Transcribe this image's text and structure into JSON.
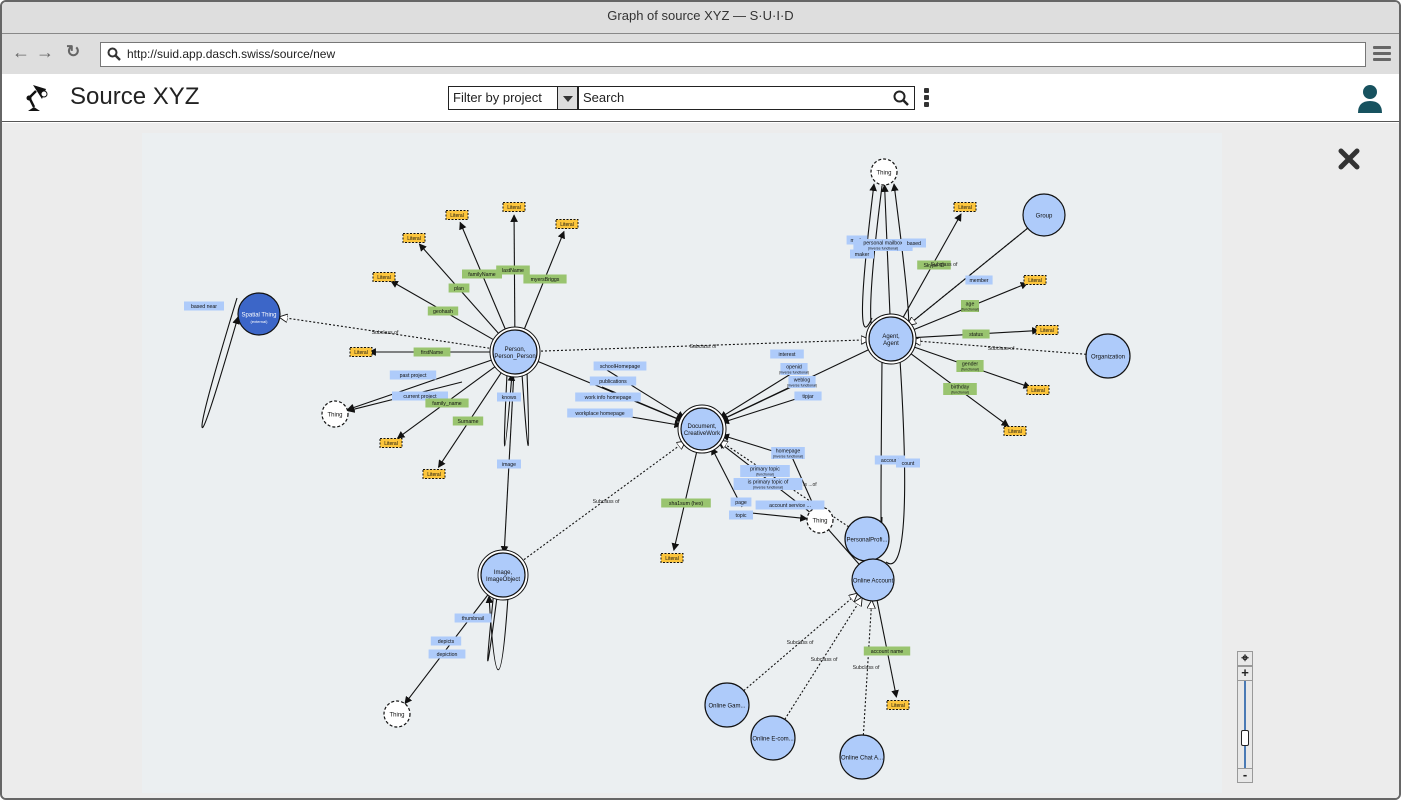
{
  "window": {
    "title": "Graph of source XYZ — S·U·I·D"
  },
  "browser": {
    "url": "http://suid.app.dasch.swiss/source/new"
  },
  "header": {
    "title": "Source XYZ",
    "filter_label": "Filter by project",
    "search_placeholder": "Search"
  },
  "colors": {
    "class_node": "#aecbfa",
    "external_node": "#3c66c8",
    "thing_node": "#ffffff",
    "literal": "#fcc53c",
    "object_property": "#aecbfa",
    "datatype_property": "#99c46f",
    "accent": "#17525f"
  },
  "zoom_control": {
    "level": 0.25
  },
  "graph": {
    "nodes": [
      {
        "id": "spatial",
        "label": "Spatial Thing",
        "sub": "(external)",
        "type": "external"
      },
      {
        "id": "person",
        "label": "Person,\nPerson_Person",
        "type": "class"
      },
      {
        "id": "document",
        "label": "Document,\nCreativeWork",
        "type": "class"
      },
      {
        "id": "agent",
        "label": "Agent,\nAgent",
        "type": "class"
      },
      {
        "id": "image",
        "label": "Image,\nImageObject",
        "type": "class"
      },
      {
        "id": "group",
        "label": "Group",
        "type": "plain"
      },
      {
        "id": "organization",
        "label": "Organization",
        "type": "plain"
      },
      {
        "id": "profile",
        "label": "PersonalProfi...",
        "type": "plain"
      },
      {
        "id": "account",
        "label": "Online Account",
        "type": "plain"
      },
      {
        "id": "gaming",
        "label": "Online Gam...",
        "type": "plain"
      },
      {
        "id": "ecom",
        "label": "Online E-com...",
        "type": "plain"
      },
      {
        "id": "chat",
        "label": "Online Chat A...",
        "type": "plain"
      },
      {
        "id": "thing1",
        "label": "Thing",
        "type": "thing"
      },
      {
        "id": "thing2",
        "label": "Thing",
        "type": "thing"
      },
      {
        "id": "thing3",
        "label": "Thing",
        "type": "thing"
      },
      {
        "id": "thing4",
        "label": "Thing",
        "type": "thing"
      }
    ],
    "literals": [
      "Literal",
      "Literal",
      "Literal",
      "Literal",
      "Literal",
      "Literal",
      "Literal",
      "Literal",
      "Literal",
      "Literal",
      "Literal",
      "Literal",
      "Literal",
      "Literal",
      "Literal"
    ],
    "properties": {
      "based_near": "based near",
      "geohash": "geohash",
      "plan": "plan",
      "familyName": "familyName",
      "lastName": "lastName",
      "myersBriggs": "myersBriggs",
      "firstName": "firstName",
      "past_project": "past project",
      "current_project": "current project",
      "family_name": "family_name",
      "surname": "Surname",
      "knows": "knows",
      "image": "image",
      "school_homepage": "schoolHomepage",
      "publications": "publications",
      "work_info_homepage": "work info homepage",
      "workplace_homepage": "workplace homepage",
      "sha1sum": "sha1sum (hex)",
      "thumbnail": "thumbnail",
      "depicts": "depicts",
      "depiction": "depiction",
      "homepage": "homepage",
      "homepage_sub": "(inverse functional)",
      "primary_topic": "primary topic",
      "primary_topic_sub": "(functional)",
      "is_primary_topic_of": "is primary topic of",
      "is_primary_topic_of_sub": "(inverse functional)",
      "page": "page",
      "topic": "topic",
      "account_service": "account service ...",
      "interest": "interest",
      "openid": "openid",
      "openid_sub": "(inverse functional)",
      "weblog": "weblog",
      "weblog_sub": "(inverse functional)",
      "tipjar": "tipjar",
      "made": "made",
      "maker": "maker",
      "personal_mailbox": "personal mailbox",
      "personal_mailbox_sub": "(inverse functional)",
      "mbox_sha1sum": "based",
      "skype_id": "Skype ID",
      "member": "member",
      "age": "age",
      "age_sub": "(functional)",
      "status": "status",
      "gender": "gender",
      "gender_sub": "(functional)",
      "birthday": "birthday",
      "birthday_sub": "(functional)",
      "account": "account",
      "holds_account": "count",
      "account_name": "account name",
      "is_topic_of": "is ...of"
    },
    "subclass_label": "Subclass of"
  }
}
